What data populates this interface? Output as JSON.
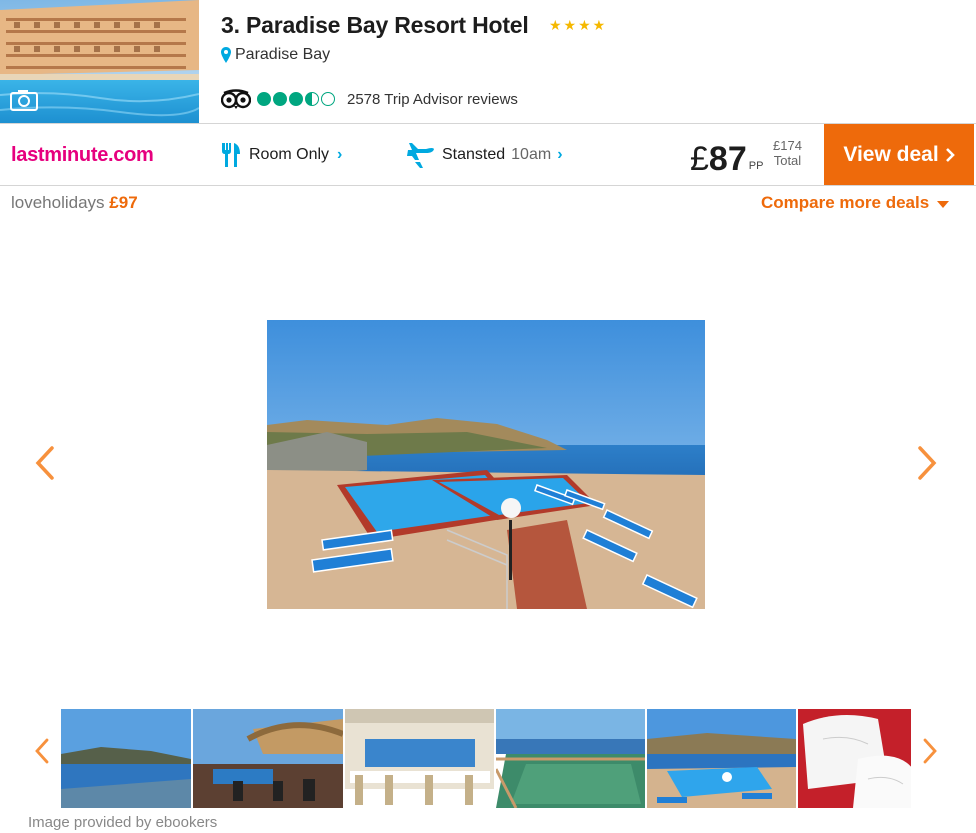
{
  "hotel": {
    "title": "3. Paradise Bay Resort Hotel",
    "stars": "★★★★",
    "star_count": 4,
    "location": "Paradise Bay",
    "reviews": "2578 Trip Advisor reviews",
    "rating_bubbles": 3.5
  },
  "deal": {
    "provider": "lastminute.com",
    "board": "Room Only",
    "airport": "Stansted",
    "departure_time": "10am",
    "currency": "£",
    "price": "87",
    "price_unit": "PP",
    "total_price": "£174",
    "total_label": "Total",
    "cta": "View deal"
  },
  "alternative": {
    "provider": "loveholidays",
    "price": "£97"
  },
  "compare_label": "Compare more deals",
  "gallery": {
    "caption": "Image provided by ebookers",
    "thumbnails": [
      "thumb-1",
      "thumb-2",
      "thumb-3",
      "thumb-4",
      "thumb-5",
      "thumb-6"
    ]
  },
  "colors": {
    "accent": "#ee6a0b",
    "arrow": "#f7913d",
    "provider_brand": "#e6007e",
    "link_blue": "#00a9e0",
    "tripadvisor_green": "#00a680",
    "star": "#f5b800"
  },
  "icons": {
    "camera": "camera-icon",
    "pin": "map-pin-icon",
    "tripadvisor": "tripadvisor-owl-icon",
    "board": "fork-knife-icon",
    "flight": "plane-icon",
    "prev": "chevron-left-icon",
    "next": "chevron-right-icon"
  }
}
